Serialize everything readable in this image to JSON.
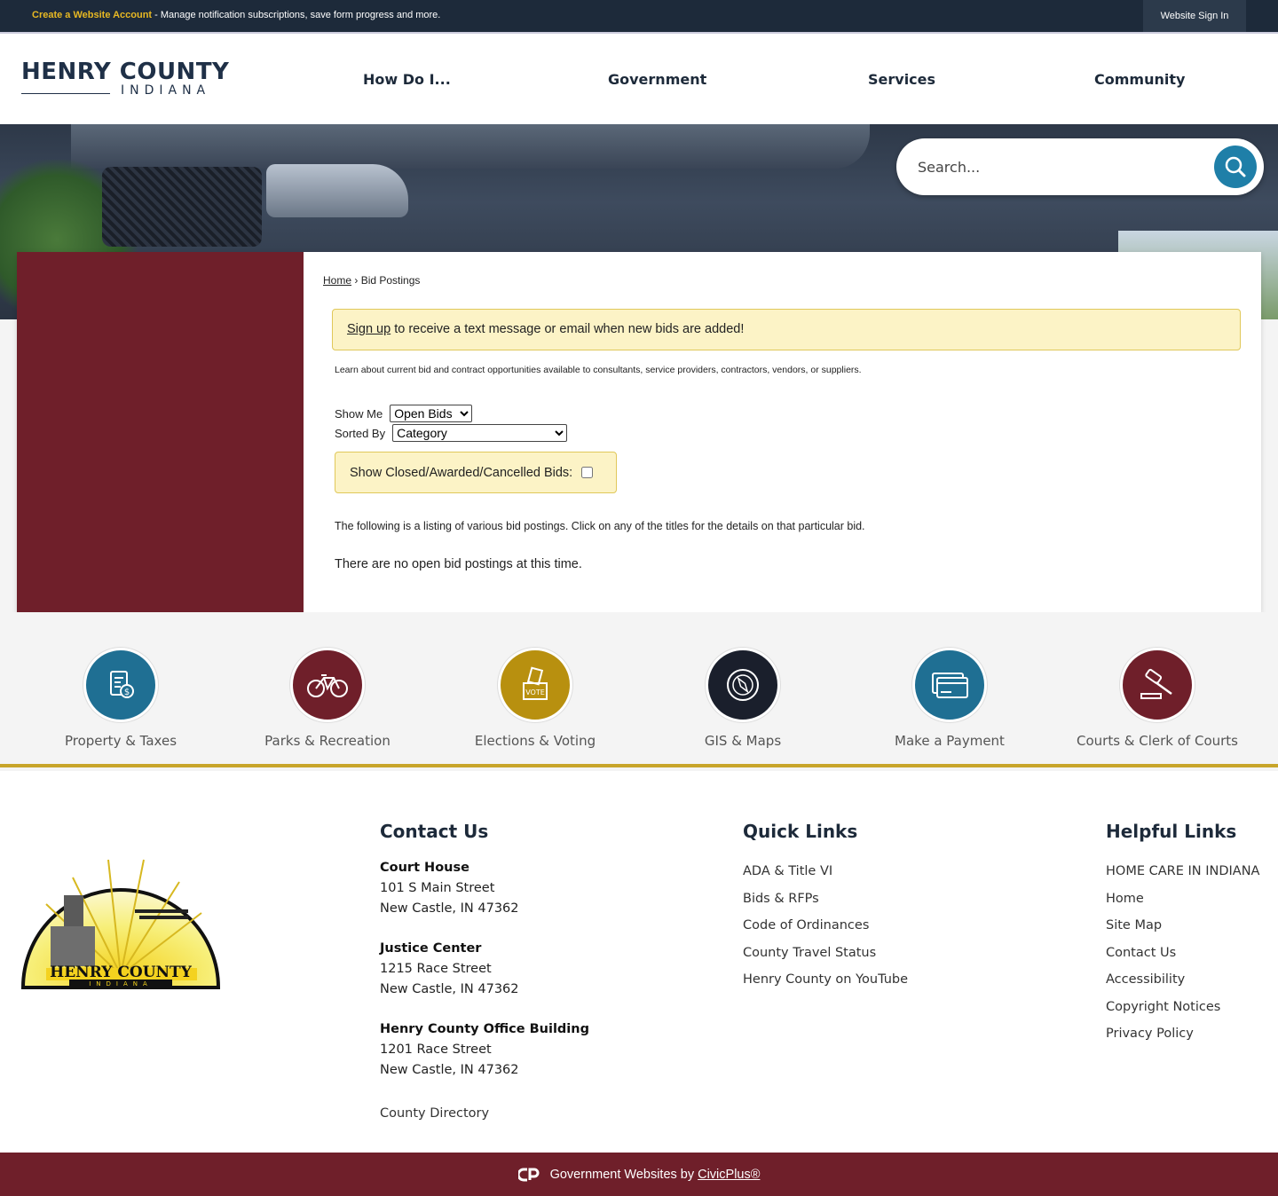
{
  "topbar": {
    "create_link": "Create a Website Account",
    "message": " - Manage notification subscriptions, save form progress and more.",
    "signin": "Website Sign In"
  },
  "header": {
    "logo_line1": "HENRY COUNTY",
    "logo_line2": "INDIANA",
    "nav": [
      "How Do I...",
      "Government",
      "Services",
      "Community"
    ]
  },
  "search": {
    "placeholder": "Search..."
  },
  "breadcrumb": {
    "home": "Home",
    "separator": "›",
    "current": "Bid Postings"
  },
  "alert": {
    "link": "Sign up",
    "text": " to receive a text message or email when new bids are added!"
  },
  "intro": "Learn about current bid and contract opportunities available to consultants, service providers, contractors, vendors, or suppliers.",
  "filters": {
    "show_me_label": "Show Me",
    "show_me_value": "Open Bids",
    "sorted_by_label": "Sorted By",
    "sorted_by_value": "Category",
    "closed_label": "Show Closed/Awarded/Cancelled Bids:"
  },
  "listing_text": "The following is a listing of various bid postings. Click on any of the titles for the details on that particular bid.",
  "no_postings": "There are no open bid postings at this time.",
  "quick_links": [
    {
      "label": "Property & Taxes",
      "icon": "document-dollar-icon",
      "color": "#1f6f93"
    },
    {
      "label": "Parks & Recreation",
      "icon": "bicycle-icon",
      "color": "#6f1f2a"
    },
    {
      "label": "Elections & Voting",
      "icon": "ballot-box-icon",
      "color": "#b8900f"
    },
    {
      "label": "GIS & Maps",
      "icon": "compass-icon",
      "color": "#1a1f2c"
    },
    {
      "label": "Make a Payment",
      "icon": "credit-card-icon",
      "color": "#1f6f93"
    },
    {
      "label": "Courts & Clerk of Courts",
      "icon": "gavel-icon",
      "color": "#6f1f2a"
    }
  ],
  "footer": {
    "seal_text": "HENRY COUNTY",
    "seal_sub": "INDIANA",
    "contact_title": "Contact Us",
    "addresses": [
      {
        "name": "Court House",
        "line1": "101 S Main Street",
        "line2": "New Castle, IN 47362"
      },
      {
        "name": "Justice Center",
        "line1": "1215 Race Street",
        "line2": "New Castle, IN 47362"
      },
      {
        "name": "Henry County Office Building",
        "line1": "1201 Race Street",
        "line2": "New Castle, IN 47362"
      }
    ],
    "directory": "County Directory",
    "quick_title": "Quick Links",
    "quick": [
      "ADA & Title VI",
      "Bids & RFPs",
      "Code of Ordinances",
      "County Travel Status",
      "Henry County on YouTube"
    ],
    "helpful_title": "Helpful Links",
    "helpful": [
      "HOME CARE IN INDIANA",
      "Home",
      "Site Map",
      "Contact Us",
      "Accessibility",
      "Copyright Notices",
      "Privacy Policy"
    ]
  },
  "bottom": {
    "text": "Government Websites by",
    "link": "CivicPlus®"
  }
}
